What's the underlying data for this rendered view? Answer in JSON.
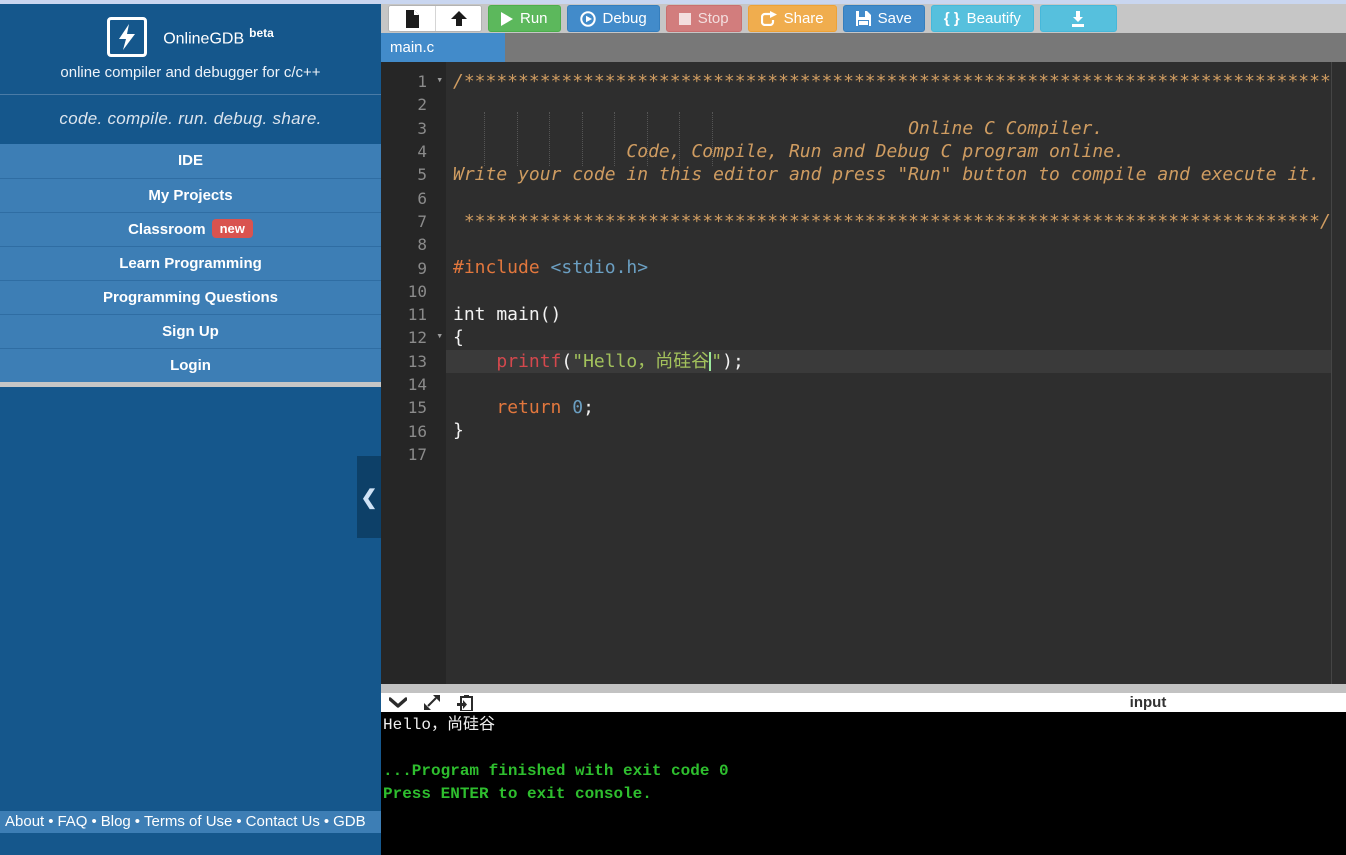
{
  "colors": {
    "sidebar_blue": "#15578c",
    "menu_blue": "#3d7eb5",
    "badge_red": "#d9534f",
    "run_green": "#5cb85c",
    "debug_blue": "#428bca",
    "stop_red": "#d27d7d",
    "share_orange": "#f0ad4e",
    "save_blue": "#428bca",
    "beautify_cyan": "#56c0dd",
    "editor_bg": "#2e2e2e",
    "console_green": "#2ebe2e"
  },
  "sidebar": {
    "brand": {
      "title": "OnlineGDB",
      "beta": "beta",
      "subtitle": "online compiler and debugger for c/c++",
      "logo_icon": "lightning-bolt-icon"
    },
    "tagline": "code. compile. run. debug. share.",
    "menu": [
      {
        "label": "IDE"
      },
      {
        "label": "My Projects"
      },
      {
        "label": "Classroom",
        "badge": "new"
      },
      {
        "label": "Learn Programming"
      },
      {
        "label": "Programming Questions"
      },
      {
        "label": "Sign Up"
      },
      {
        "label": "Login"
      }
    ],
    "collapse_icon": "❮"
  },
  "footer": {
    "links": [
      "About",
      "FAQ",
      "Blog",
      "Terms of Use",
      "Contact Us",
      "GDB"
    ],
    "separator": "•"
  },
  "toolbar": {
    "new_file_icon": "new-file-icon",
    "open_icon": "upload-icon",
    "run_label": "Run",
    "debug_label": "Debug",
    "stop_label": "Stop",
    "share_label": "Share",
    "save_label": "Save",
    "beautify_brace": "{ }",
    "beautify_label": "Beautify",
    "download_icon": "download-icon"
  },
  "tabs": [
    {
      "label": "main.c",
      "active": true
    }
  ],
  "editor": {
    "active_line": 13,
    "fold_lines": [
      1,
      12
    ],
    "lines": [
      {
        "num": 1,
        "segments": [
          {
            "t": "/********************************************************************************",
            "s": "comment"
          }
        ]
      },
      {
        "num": 2,
        "segments": []
      },
      {
        "num": 3,
        "segments": [
          {
            "t": "                                          Online C Compiler.",
            "s": "comment"
          }
        ]
      },
      {
        "num": 4,
        "segments": [
          {
            "t": "                Code, Compile, Run and Debug C program online.",
            "s": "comment"
          }
        ]
      },
      {
        "num": 5,
        "segments": [
          {
            "t": "Write your code in this editor and press \"Run\" button to compile and execute it.",
            "s": "comment"
          }
        ]
      },
      {
        "num": 6,
        "segments": []
      },
      {
        "num": 7,
        "segments": [
          {
            "t": " *******************************************************************************/",
            "s": "comment"
          }
        ]
      },
      {
        "num": 8,
        "segments": []
      },
      {
        "num": 9,
        "segments": [
          {
            "t": "#include",
            "s": "directive"
          },
          {
            "t": " ",
            "s": "plain"
          },
          {
            "t": "<stdio.h>",
            "s": "incpath"
          }
        ]
      },
      {
        "num": 10,
        "segments": []
      },
      {
        "num": 11,
        "segments": [
          {
            "t": "int main()",
            "s": "plain"
          }
        ]
      },
      {
        "num": 12,
        "segments": [
          {
            "t": "{",
            "s": "plain"
          }
        ]
      },
      {
        "num": 13,
        "segments": [
          {
            "t": "    ",
            "s": "plain"
          },
          {
            "t": "printf",
            "s": "func"
          },
          {
            "t": "(",
            "s": "plain"
          },
          {
            "t": "\"Hello，尚硅谷",
            "s": "string"
          },
          {
            "cursor": true
          },
          {
            "t": "\"",
            "s": "string"
          },
          {
            "t": ");",
            "s": "plain"
          }
        ]
      },
      {
        "num": 14,
        "segments": []
      },
      {
        "num": 15,
        "segments": [
          {
            "t": "    ",
            "s": "plain"
          },
          {
            "t": "return",
            "s": "keyword"
          },
          {
            "t": " ",
            "s": "plain"
          },
          {
            "t": "0",
            "s": "number"
          },
          {
            "t": ";",
            "s": "plain"
          }
        ]
      },
      {
        "num": 16,
        "segments": [
          {
            "t": "}",
            "s": "plain"
          }
        ]
      },
      {
        "num": 17,
        "segments": []
      }
    ]
  },
  "console": {
    "header_label": "input",
    "icons": [
      "collapse-console-icon",
      "expand-console-icon",
      "paste-to-console-icon"
    ],
    "lines": [
      {
        "text": "Hello，尚硅谷",
        "style": "output"
      },
      {
        "text": "",
        "style": "output"
      },
      {
        "text": "...Program finished with exit code 0",
        "style": "status"
      },
      {
        "text": "Press ENTER to exit console.",
        "style": "status"
      }
    ]
  }
}
